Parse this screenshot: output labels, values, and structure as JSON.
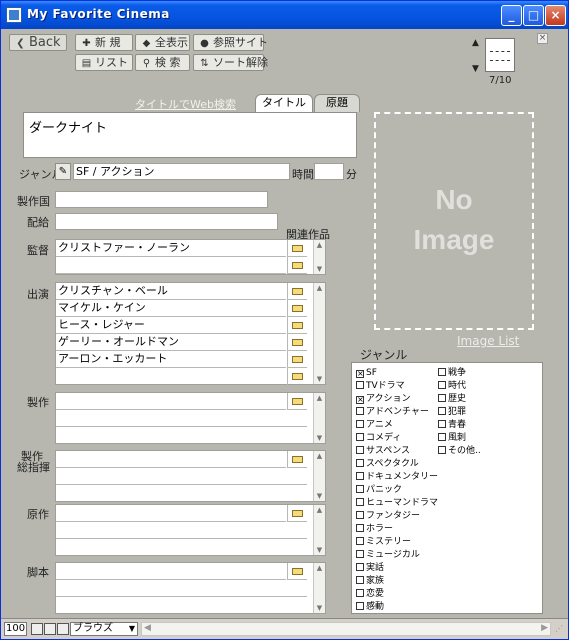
{
  "window": {
    "title": "My Favorite Cinema",
    "minimize_glyph": "_",
    "maximize_glyph": "□",
    "close_glyph": "×"
  },
  "toolbar": {
    "back_label": "Back",
    "new_label": "新 規",
    "show_all_label": "全表示",
    "reference_site_label": "参照サイト",
    "list_label": "リスト",
    "search_label": "検 索",
    "sort_release_label": "ソート解除"
  },
  "nav": {
    "up_glyph": "▲",
    "down_glyph": "▼",
    "record_counter": "7/10",
    "close_glyph": "×"
  },
  "record": {
    "web_search_link": "タイトルでWeb検索",
    "tabs": [
      "タイトル",
      "原題"
    ],
    "title_value": "ダークナイト",
    "genre_label": "ジャンル",
    "genre_value": "SF / アクション",
    "runtime_label": "時間",
    "runtime_value": "",
    "runtime_unit": "分",
    "country_label": "製作国",
    "country_value": "",
    "distribution_label": "配給",
    "distribution_value": "",
    "related_header": "関連作品",
    "director_label": "監督",
    "directors": [
      "クリストファー・ノーラン",
      ""
    ],
    "cast_label": "出演",
    "cast": [
      "クリスチャン・ベール",
      "マイケル・ケイン",
      "ヒース・レジャー",
      "ゲーリー・オールドマン",
      "アーロン・エッカート"
    ],
    "producer_label": "製作",
    "executive_label_line1": "製作",
    "executive_label_line2": "総指揮",
    "original_label": "原作",
    "screenplay_label": "脚本"
  },
  "image_panel": {
    "line1": "No",
    "line2": "Image",
    "image_list_link": "Image List"
  },
  "genre_panel": {
    "header": "ジャンル",
    "col1": [
      {
        "label": "SF",
        "checked": true
      },
      {
        "label": "TVドラマ",
        "checked": false
      },
      {
        "label": "アクション",
        "checked": true
      },
      {
        "label": "アドベンチャー",
        "checked": false
      },
      {
        "label": "アニメ",
        "checked": false
      },
      {
        "label": "コメディ",
        "checked": false
      },
      {
        "label": "サスペンス",
        "checked": false
      },
      {
        "label": "スペクタクル",
        "checked": false
      },
      {
        "label": "ドキュメンタリー",
        "checked": false
      },
      {
        "label": "パニック",
        "checked": false
      },
      {
        "label": "ヒューマンドラマ",
        "checked": false
      },
      {
        "label": "ファンタジー",
        "checked": false
      },
      {
        "label": "ホラー",
        "checked": false
      },
      {
        "label": "ミステリー",
        "checked": false
      },
      {
        "label": "ミュージカル",
        "checked": false
      },
      {
        "label": "実話",
        "checked": false
      },
      {
        "label": "家族",
        "checked": false
      },
      {
        "label": "恋愛",
        "checked": false
      },
      {
        "label": "感動",
        "checked": false
      }
    ],
    "col2": [
      {
        "label": "戦争",
        "checked": false
      },
      {
        "label": "時代",
        "checked": false
      },
      {
        "label": "歴史",
        "checked": false
      },
      {
        "label": "犯罪",
        "checked": false
      },
      {
        "label": "青春",
        "checked": false
      },
      {
        "label": "風刺",
        "checked": false
      },
      {
        "label": "その他..",
        "checked": false
      }
    ]
  },
  "status_bar": {
    "zoom": "100",
    "mode": "ブラウズ",
    "mode_arrow": "▼"
  }
}
